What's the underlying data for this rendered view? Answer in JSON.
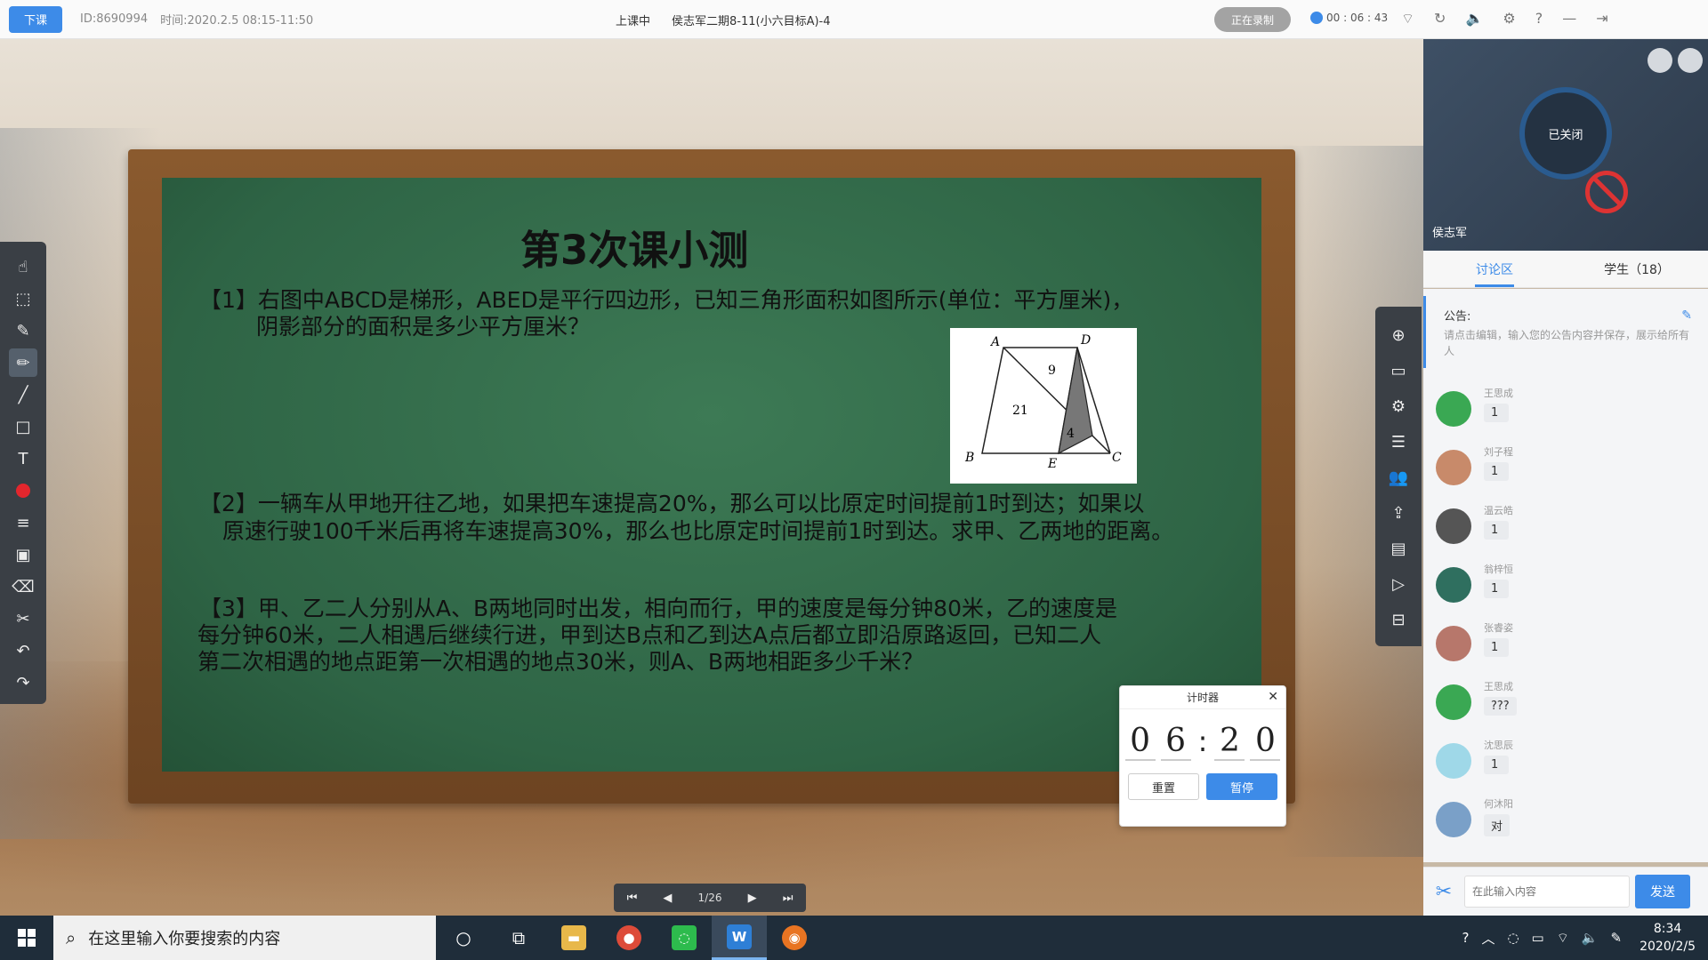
{
  "topbar": {
    "end_class": "下课",
    "id": "ID:8690994",
    "time": "时间:2020.2.5 08:15-11:50",
    "status": "上课中",
    "title": "侯志军二期8-11(小六目标A)-4",
    "recording": "正在录制",
    "timer": "00 : 06 : 43"
  },
  "board": {
    "title": "第3次课小测",
    "q1_line1": "【1】右图中ABCD是梯形，ABED是平行四边形，已知三角形面积如图所示(单位：平方厘米)，",
    "q1_line2": "阴影部分的面积是多少平方厘米？",
    "q2_line1": "【2】一辆车从甲地开往乙地，如果把车速提高20%，那么可以比原定时间提前1时到达；如果以",
    "q2_line2": "原速行驶100千米后再将车速提高30%，那么也比原定时间提前1时到达。求甲、乙两地的距离。",
    "q3_line1": "【3】甲、乙二人分别从A、B两地同时出发，相向而行，甲的速度是每分钟80米，乙的速度是",
    "q3_line2": "每分钟60米，二人相遇后继续行进，甲到达B点和乙到达A点后都立即沿原路返回，已知二人",
    "q3_line3": "第二次相遇的地点距第一次相遇的地点30米，则A、B两地相距多少千米？",
    "figure": {
      "labels": {
        "A": "A",
        "D": "D",
        "B": "B",
        "E": "E",
        "C": "C"
      },
      "areas": {
        "upper": "9",
        "left": "21",
        "lower": "4"
      }
    }
  },
  "timer_widget": {
    "title": "计时器",
    "digits": [
      "0",
      "6",
      "2",
      "0"
    ],
    "reset": "重置",
    "pause": "暂停"
  },
  "pager": {
    "page": "1/26"
  },
  "video": {
    "state": "已关闭",
    "teacher": "侯志军"
  },
  "tabs": {
    "discussion": "讨论区",
    "students": "学生（18）"
  },
  "notice": {
    "title": "公告:",
    "text": "请点击编辑，输入您的公告内容并保存，展示给所有人"
  },
  "messages": [
    {
      "name": "王思成",
      "text": "1",
      "color": "#3aa853"
    },
    {
      "name": "刘子程",
      "text": "1",
      "color": "#c88a6a"
    },
    {
      "name": "温云皓",
      "text": "1",
      "color": "#555555"
    },
    {
      "name": "翁梓恒",
      "text": "1",
      "color": "#2f6f5f"
    },
    {
      "name": "张睿姿",
      "text": "1",
      "color": "#b7776b"
    },
    {
      "name": "王思成",
      "text": "???",
      "color": "#3aa853"
    },
    {
      "name": "沈思辰",
      "text": "1",
      "color": "#9fd8e8"
    },
    {
      "name": "何沐阳",
      "text": "对",
      "color": "#7aa0c8"
    }
  ],
  "input": {
    "placeholder": "在此输入内容",
    "send": "发送"
  },
  "taskbar": {
    "search_placeholder": "在这里输入你要搜索的内容",
    "time": "8:34",
    "date": "2020/2/5"
  }
}
